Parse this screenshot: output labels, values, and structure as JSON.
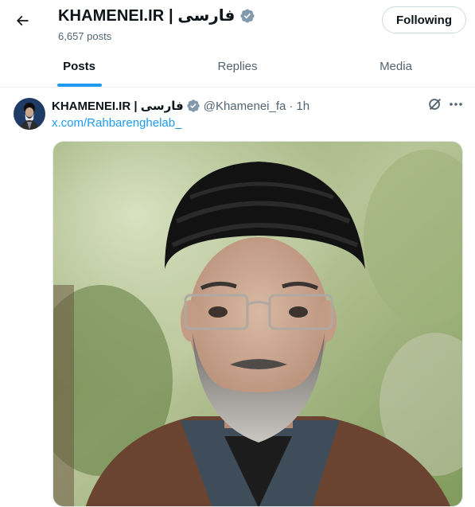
{
  "header": {
    "title": "KHAMENEI.IR | فارسی",
    "post_count": "6,657 posts",
    "follow_label": "Following"
  },
  "tabs": [
    {
      "label": "Posts",
      "active": true
    },
    {
      "label": "Replies",
      "active": false
    },
    {
      "label": "Media",
      "active": false
    }
  ],
  "post": {
    "author": "KHAMENEI.IR | فارسی",
    "handle": "@Khamenei_fa",
    "separator": "·",
    "time": "1h",
    "link_text": "x.com/Rahbarenghelab_"
  },
  "colors": {
    "accent": "#1d9bf0",
    "text_primary": "#0f1419",
    "text_secondary": "#536471",
    "verified": "#829aab"
  },
  "icons": {
    "back": "arrow-left-icon",
    "verified": "verified-badge-icon",
    "grok": "grok-icon",
    "more": "more-horizontal-icon"
  }
}
